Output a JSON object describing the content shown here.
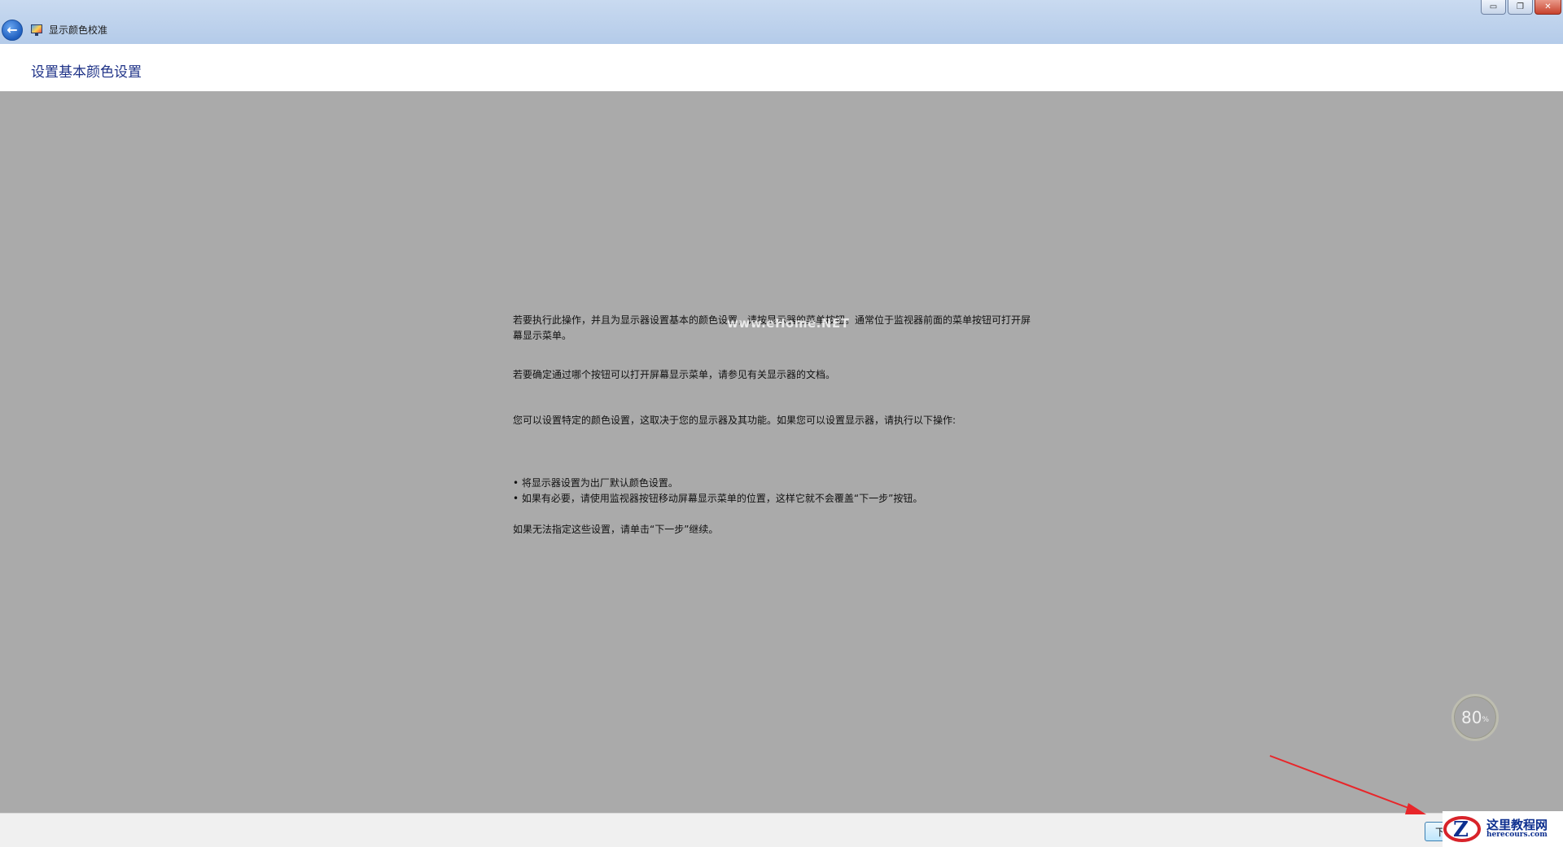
{
  "window": {
    "title": "显示颜色校准",
    "controls": {
      "minimize": "▭",
      "restore": "❐",
      "close": "✕"
    }
  },
  "header": {
    "page_title": "设置基本颜色设置"
  },
  "content": {
    "p1": "若要执行此操作，并且为显示器设置基本的颜色设置，请按显示器的菜单按钮。通常位于监视器前面的菜单按钮可打开屏幕显示菜单。",
    "p2": "若要确定通过哪个按钮可以打开屏幕显示菜单，请参见有关显示器的文档。",
    "p3": "您可以设置特定的颜色设置，这取决于您的显示器及其功能。如果您可以设置显示器，请执行以下操作:",
    "bullets": [
      "将显示器设置为出厂默认颜色设置。",
      "如果有必要，请使用监视器按钮移动屏幕显示菜单的位置，这样它就不会覆盖“下一步”按钮。"
    ],
    "p5": "如果无法指定这些设置，请单击“下一步”继续。",
    "watermark": "www.eHome.NET"
  },
  "zoom_badge": {
    "value": "80",
    "unit": "%"
  },
  "footer": {
    "next_label": "下"
  },
  "logo": {
    "cn": "这里教程网",
    "en": "herecours.com",
    "mark_letter": "Z"
  },
  "colors": {
    "accent": "#1e3287",
    "arrow": "#e8262a",
    "background": "#aaaaaa"
  }
}
